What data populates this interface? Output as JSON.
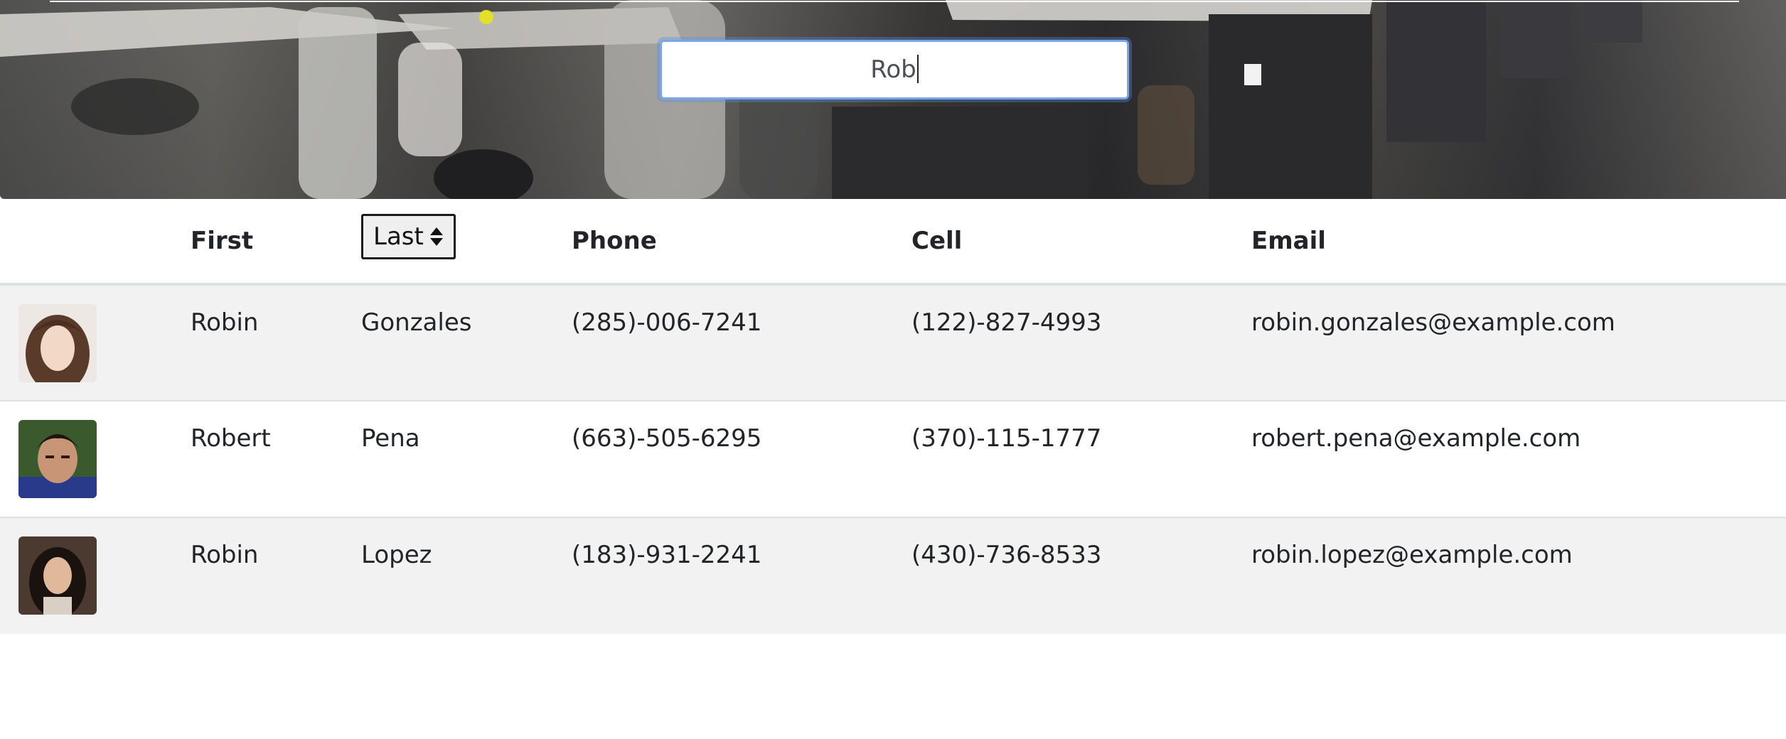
{
  "search": {
    "value": "Rob"
  },
  "table": {
    "headers": {
      "first": "First",
      "last": "Last",
      "phone": "Phone",
      "cell": "Cell",
      "email": "Email"
    },
    "rows": [
      {
        "first": "Robin",
        "last": "Gonzales",
        "phone": "(285)-006-7241",
        "cell": "(122)-827-4993",
        "email": "robin.gonzales@example.com"
      },
      {
        "first": "Robert",
        "last": "Pena",
        "phone": "(663)-505-6295",
        "cell": "(370)-115-1777",
        "email": "robert.pena@example.com"
      },
      {
        "first": "Robin",
        "last": "Lopez",
        "phone": "(183)-931-2241",
        "cell": "(430)-736-8533",
        "email": "robin.lopez@example.com"
      }
    ]
  },
  "icons": {
    "sort": "sort-up-down-icon"
  }
}
